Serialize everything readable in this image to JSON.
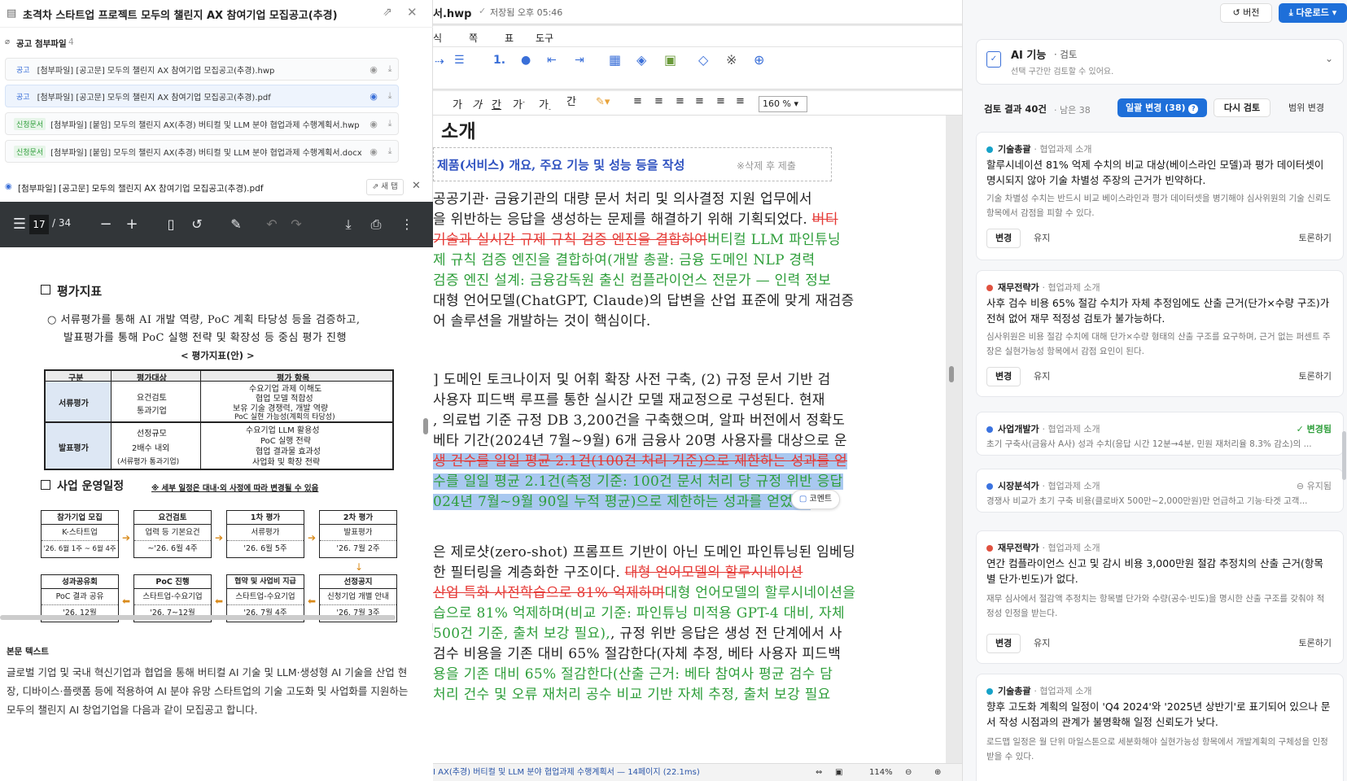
{
  "left": {
    "title": "초격차 스타트업 프로젝트 모두의 챌린지 AX 참여기업 모집공고(추경)",
    "attachments_label": "공고 첨부파일",
    "attachments_count": "4",
    "attachments": [
      {
        "tag": "공고",
        "name": "[첨부파일] [공고문] 모두의 챌린지 AX 참여기업 모집공고(추경).hwp"
      },
      {
        "tag": "공고",
        "name": "[첨부파일] [공고문] 모두의 챌린지 AX 참여기업 모집공고(추경).pdf"
      },
      {
        "tag": "신청문서",
        "name": "[첨부파일] [붙임] 모두의 챌린지 AX(추경) 버티컬 및 LLM 분야 협업과제 수행계획서.hwp"
      },
      {
        "tag": "신청문서",
        "name": "[첨부파일] [붙임] 모두의 챌린지 AX(추경) 버티컬 및 LLM 분야 협업과제 수행계획서.docx"
      }
    ],
    "preview_file": "[첨부파일] [공고문] 모두의 챌린지 AX 참여기업 모집공고(추경).pdf",
    "new_window_label": "새 탭",
    "pdf": {
      "page": "17",
      "total": "/ 34",
      "sec1_title": "평가지표",
      "sec1_bullet_1": "○  서류평가를 통해 AI 개발 역량, PoC 계획 타당성 등을 검증하고,",
      "sec1_bullet_2": "발표평가를 통해 PoC 실행 전략 및 확장성 등 중심 평가 진행",
      "table_title": "< 평가지표(안) >",
      "table_headers": [
        "구분",
        "평가대상",
        "평가 항목"
      ],
      "row1_kind": "서류평가",
      "row1_target_1": "요건검토",
      "row1_target_2": "통과기업",
      "row1_items": [
        "수요기업 과제 이해도",
        "협업 모델 적합성",
        "보유 기술 경쟁력, 개발 역량",
        "PoC 실현 가능성(계획의 타당성)"
      ],
      "row2_kind": "발표평가",
      "row2_target_1": "선정규모",
      "row2_target_2": "2배수 내외",
      "row2_target_3": "(서류평가 통과기업)",
      "row2_items": [
        "수요기업 LLM 활용성",
        "PoC 실행 전략",
        "협업 결과물 효과성",
        "사업화 및 확장 전략"
      ],
      "sec2_title": "사업 운영일정",
      "sec2_note": "※ 세부 일정은 대내·외 사정에 따라 변경될 수 있음",
      "steps": [
        {
          "title": "참가기업 모집",
          "r1": "K-스타트업",
          "r2": "'26. 6월 1주 ~ 6월 4주"
        },
        {
          "title": "요건검토",
          "r1": "업력 등 기본요건",
          "r2": "~'26. 6월 4주"
        },
        {
          "title": "1차 평가",
          "r1": "서류평가",
          "r2": "'26. 6월 5주"
        },
        {
          "title": "2차 평가",
          "r1": "발표평가",
          "r2": "'26. 7월 2주"
        },
        {
          "title": "성과공유회",
          "r1": "PoC 결과 공유",
          "r2": "'26. 12월"
        },
        {
          "title": "PoC 진행",
          "r1": "스타트업-수요기업",
          "r2": "'26. 7~12월"
        },
        {
          "title": "협약 및 사업비 지급",
          "r1": "스타트업-수요기업",
          "r2": "'26. 7월 4주"
        },
        {
          "title": "선정공지",
          "r1": "신청기업 개별 안내",
          "r2": "'26. 7월 3주"
        }
      ]
    },
    "body_label": "본문 텍스트",
    "body_text": "글로벌 기업 및 국내 혁신기업과 협업을 통해 버티컬 AI 기술 및 LLM·생성형 AI 기술을 산업 현장, 디바이스·플랫폼 등에 적용하여 AI 분야 유망 스타트업의 기술 고도화 및 사업화를 지원하는 모두의 챌린지 AI 창업기업을 다음과 같이 모집공고 합니다."
  },
  "editor": {
    "filename": "서.hwp",
    "saved": "저장됨 오후 05:46",
    "menu": [
      "식",
      "쪽",
      "표",
      "도구"
    ],
    "zoom": "160 %",
    "heading": "소개",
    "guide_text": "제품(서비스) 개요, 주요 기능 및 성능 등을 작성",
    "guide_note": "※삭제 후 제출",
    "para1": [
      {
        "segs": [
          {
            "t": "공공기관· 금융기관의 대량 문서 처리 및 의사결정 지원 업무에서",
            "c": ""
          }
        ]
      },
      {
        "segs": [
          {
            "t": "을 위반하는 응답을 생성하는 문제를 해결하기 위해 기획되었다. ",
            "c": ""
          },
          {
            "t": "버티",
            "c": "del"
          }
        ]
      },
      {
        "segs": [
          {
            "t": " 기술과 실시간 규제 규칙 검증 엔진을 결합하여",
            "c": "del"
          },
          {
            "t": "버티컬 LLM 파인튜닝",
            "c": "ins"
          }
        ]
      },
      {
        "segs": [
          {
            "t": "제 규칙 검증 엔진을 결합하여(개발 총괄: 금융 도메인 NLP 경력",
            "c": "ins"
          }
        ]
      },
      {
        "segs": [
          {
            "t": "검증 엔진 설계: 금융감독원 출신 컴플라이언스 전문가 — 인력 정보",
            "c": "ins"
          }
        ]
      },
      {
        "segs": [
          {
            "t": " 대형 언어모델(ChatGPT, Claude)의 답변을 산업 표준에 맞게 재검증",
            "c": ""
          }
        ]
      },
      {
        "segs": [
          {
            "t": "어 솔루션을 개발하는 것이 핵심이다.",
            "c": ""
          }
        ]
      }
    ],
    "para2": [
      {
        "segs": [
          {
            "t": "] 도메인 토크나이저 및 어휘 확장 사전 구축, (2) 규정 문서 기반 검",
            "c": ""
          }
        ]
      },
      {
        "segs": [
          {
            "t": " 사용자 피드백 루프를 통한 실시간 모델 재교정으로 구성된다. 현재",
            "c": ""
          }
        ]
      },
      {
        "segs": [
          {
            "t": ", 의료법 기준 규정 DB 3,200건을 구축했으며, 알파 버전에서 정확도",
            "c": ""
          }
        ]
      },
      {
        "segs": [
          {
            "t": " 베타 기간(2024년 7월~9월) 6개 금융사 20명 사용자를 대상으로 운",
            "c": ""
          }
        ]
      },
      {
        "segs": [
          {
            "t": "생 건수를 일일 평균 2.1건(100건 처리 기준)으로 제한하는 성과를 얻",
            "c": "del hl"
          }
        ]
      },
      {
        "segs": [
          {
            "t": "수를 일일 평균 2.1건(측정 기준: 100건 문서 처리 당 규정 위반 응답",
            "c": "ins hl"
          }
        ]
      },
      {
        "segs": [
          {
            "t": "024년 7월~9월 90일 누적 평균)으로 제한하는 성과를 얻었다.",
            "c": "ins hl"
          }
        ]
      }
    ],
    "comment_label": "코멘트",
    "para3": [
      {
        "segs": [
          {
            "t": "은 제로샷(zero-shot) 프롬프트 기반이 아닌 도메인 파인튜닝된 임베딩",
            "c": ""
          }
        ]
      },
      {
        "segs": [
          {
            "t": "한 필터링을 계층화한 구조이다. ",
            "c": ""
          },
          {
            "t": "대형 언어모델의 할루시네이션",
            "c": "del"
          }
        ]
      },
      {
        "segs": [
          {
            "t": "산업 특화 사전학습으로 81% 억제하며",
            "c": "del"
          },
          {
            "t": "대형 언어모델의 할루시네이션을",
            "c": "ins"
          }
        ]
      },
      {
        "segs": [
          {
            "t": "습으로 81% 억제하며(비교 기준: 파인튜닝 미적용 GPT-4 대비, 자체",
            "c": "ins"
          }
        ]
      },
      {
        "segs": [
          {
            "t": "500건 기준, 출처 보강 필요),",
            "c": "ins"
          },
          {
            "t": ", 규정 위반 응답은 생성 전 단계에서 사",
            "c": ""
          }
        ]
      },
      {
        "segs": [
          {
            "t": " 검수 비용을 기존 대비 65% 절감한다(자체 추정, 베타 사용자 피드백",
            "c": ""
          }
        ]
      },
      {
        "segs": [
          {
            "t": "용을 기존 대비 65% 절감한다(산출 근거: 베타 참여사 평균 검수 담",
            "c": "ins"
          }
        ]
      },
      {
        "segs": [
          {
            "t": "처리 건수 및 오류 재처리 공수 비교 기반 자체 추정, 출처 보강 필요",
            "c": "ins"
          }
        ]
      }
    ],
    "status_text": "I AX(추경) 버티컬 및 LLM 분야 협업과제 수행계획서 — 14페이지 (22.1ms)",
    "status_zoom": "114%"
  },
  "right": {
    "version_label": "버전",
    "download_label": "다운로드",
    "ai_title": "AI 기능",
    "ai_mode": "· 검토",
    "ai_sub": "선택 구간만 검토할 수 있어요.",
    "summary": "검토 결과 40건",
    "remaining": "· 남은 38",
    "batch_label": "일괄 변경 (38)",
    "review_label": "다시 검토",
    "range_label": "범위 변경",
    "btn_change": "변경",
    "btn_keep": "유지",
    "btn_discuss": "토론하기",
    "cards": [
      {
        "cat": "기술총괄",
        "sub": "· 협업과제 소개",
        "color": "#17a2c8",
        "title": "할루시네이션 81% 억제 수치의 비교 대상(베이스라인 모델)과 평가 데이터셋이 명시되지 않아 기술 차별성 주장의 근거가 빈약하다.",
        "desc": "기술 차별성 수치는 반드시 비교 베이스라인과 평가 데이터셋을 병기해야 심사위원의 기술 신뢰도 항목에서 감점을 피할 수 있다.",
        "status": ""
      },
      {
        "cat": "재무전략가",
        "sub": "· 협업과제 소개",
        "color": "#e0513f",
        "title": "사후 검수 비용 65% 절감 수치가 자체 추정임에도 산출 근거(단가×수량 구조)가 전혀 없어 재무 적정성 검토가 불가능하다.",
        "desc": "심사위원은 비용 절감 수치에 대해 단가×수량 형태의 산출 구조를 요구하며, 근거 없는 퍼센트 주장은 실현가능성 항목에서 감점 요인이 된다.",
        "status": ""
      },
      {
        "cat": "사업개발가",
        "sub": "· 협업과제 소개",
        "color": "#3b73e0",
        "title": "",
        "desc": "초기 구축사(금융사 A사) 성과 수치(응답 시간 12분→4분, 민원 재처리율 8.3% 감소)의 ...",
        "status": "변경됨"
      },
      {
        "cat": "시장분석가",
        "sub": "· 협업과제 소개",
        "color": "#3b73e0",
        "title": "",
        "desc": "경쟁사 비교가 초기 구축 비용(클로바X 500만~2,000만원)만 언급하고 기능·타겟 고객...",
        "status": "유지됨"
      },
      {
        "cat": "재무전략가",
        "sub": "· 협업과제 소개",
        "color": "#e0513f",
        "title": "연간 컴플라이언스 신고 및 감시 비용 3,000만원 절감 추정치의 산출 근거(항목별 단가·빈도)가 없다.",
        "desc": "재무 심사에서 절감액 추정치는 항목별 단가와 수량(공수·빈도)을 명시한 산출 구조를 갖춰야 적정성 인정을 받는다.",
        "status": ""
      },
      {
        "cat": "기술총괄",
        "sub": "· 협업과제 소개",
        "color": "#17a2c8",
        "title": "향후 고도화 계획의 일정이 'Q4 2024'와 '2025년 상반기'로 표기되어 있으나 문서 작성 시점과의 관계가 불명확해 일정 신뢰도가 낮다.",
        "desc": "로드맵 일정은 월 단위 마일스톤으로 세분화해야 실현가능성 항목에서 개발계획의 구체성을 인정받을 수 있다.",
        "status": ""
      }
    ]
  }
}
